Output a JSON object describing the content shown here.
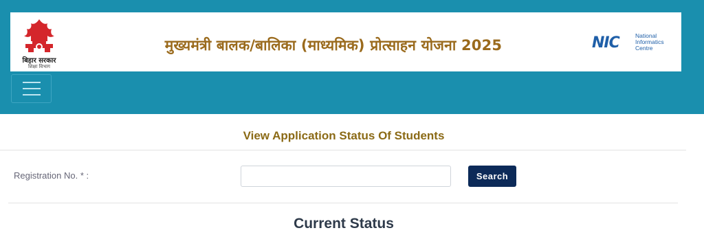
{
  "header": {
    "logo_left": {
      "icon": "bihar-emblem-icon",
      "line1": "बिहार सरकार",
      "line2": "शिक्षा विभाग",
      "color": "#d4262b"
    },
    "title": "मुख्यमंत्री बालक/बालिका (माध्यमिक) प्रोत्साहन योजना 2025",
    "logo_right": {
      "mark": "NIC",
      "text_lines": [
        "National",
        "Informatics",
        "Centre"
      ],
      "color": "#1f5fa8"
    }
  },
  "nav": {
    "menu_icon": "hamburger-menu-icon"
  },
  "main": {
    "heading": "View Application Status Of Students",
    "form": {
      "registration_label": "Registration No. * :",
      "registration_value": "",
      "registration_placeholder": "",
      "search_label": "Search"
    },
    "status_heading": "Current Status"
  },
  "colors": {
    "top_band": "#1a8fae",
    "title_gold": "#9a6a1c",
    "search_button": "#0c2a58"
  }
}
